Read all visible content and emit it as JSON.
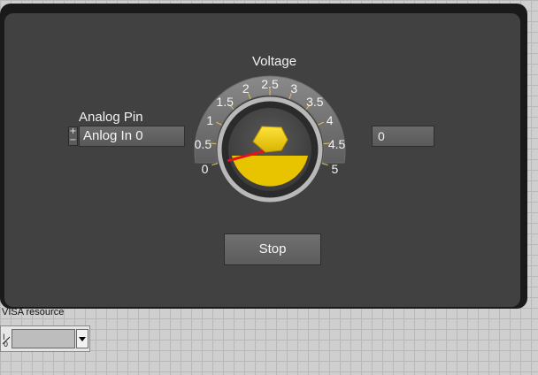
{
  "front_panel": {
    "analog_pin": {
      "label": "Analog Pin",
      "value": "Anlog In 0",
      "increment_symbol": "+",
      "decrement_symbol": "−"
    },
    "voltage_gauge": {
      "label": "Voltage",
      "scale_min": 0,
      "scale_max": 5,
      "tick_labels": [
        "0",
        "0.5",
        "1",
        "1.5",
        "2",
        "2.5",
        "3",
        "3.5",
        "4",
        "4.5",
        "5"
      ],
      "needle_value": 0,
      "needle_color": "#e3121b",
      "knob_color": "#f2cf00"
    },
    "voltage_indicator": {
      "value": "0"
    },
    "stop_button": {
      "label": "Stop"
    }
  },
  "block_area": {
    "visa_resource": {
      "label": "VISA resource",
      "icon_glyph": "I/O",
      "value": ""
    }
  }
}
